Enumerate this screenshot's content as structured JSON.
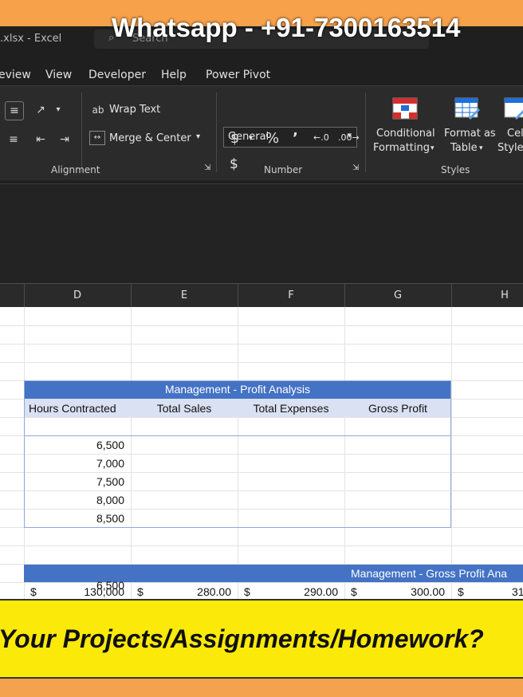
{
  "titlebar": {
    "filename": ".xlsx - Excel",
    "search_placeholder": "Search"
  },
  "watermark": "Whatsapp - +91-7300163514",
  "menu": [
    "eview",
    "View",
    "Developer",
    "Help",
    "Power Pivot"
  ],
  "ribbon": {
    "wrap_text": "Wrap Text",
    "merge_center": "Merge & Center",
    "number_format": "General",
    "currency": "$",
    "percent": "%",
    "comma": "’",
    "conditional_formatting": [
      "Conditional",
      "Formatting"
    ],
    "format_as_table": [
      "Format as",
      "Table"
    ],
    "cell_styles": [
      "Cel",
      "Styles"
    ],
    "groups": {
      "alignment": "Alignment",
      "number": "Number",
      "styles": "Styles"
    }
  },
  "columns": [
    "D",
    "E",
    "F",
    "G",
    "H"
  ],
  "table1": {
    "title": "Management - Profit Analysis",
    "headers": [
      "Hours Contracted",
      "Total Sales",
      "Total Expenses",
      "Gross Profit"
    ],
    "hours": [
      "6,500",
      "7,000",
      "7,500",
      "8,000",
      "8,500"
    ]
  },
  "table2": {
    "title": "Management - Gross Profit Ana",
    "row": [
      {
        "cur": "$",
        "val": "130,000"
      },
      {
        "cur": "$",
        "val": "280.00"
      },
      {
        "cur": "$",
        "val": "290.00"
      },
      {
        "cur": "$",
        "val": "300.00"
      },
      {
        "cur": "$",
        "val": "31"
      }
    ],
    "first_hours": "6,500"
  },
  "banner": "Your Projects/Assignments/Homework?",
  "colors": {
    "header_band": "#4472c4",
    "subheader": "#d9e1f2",
    "banner": "#fbe90a",
    "background": "#f7a24a"
  }
}
